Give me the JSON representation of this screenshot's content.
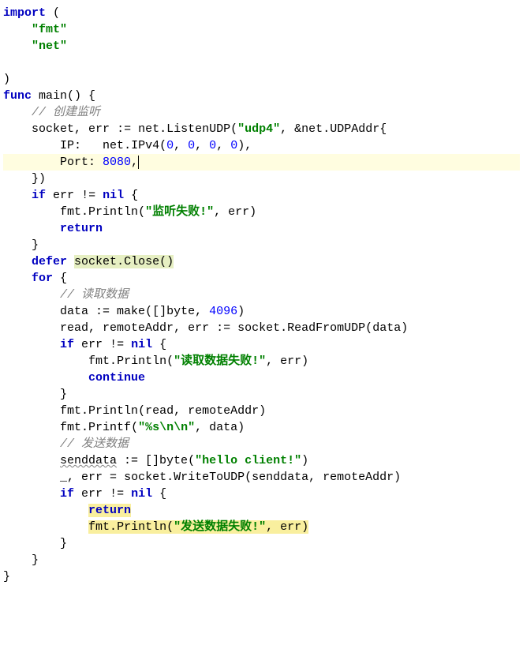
{
  "kw": {
    "import": "import",
    "func": "func",
    "if": "if",
    "defer": "defer",
    "for": "for",
    "return": "return",
    "continue": "continue"
  },
  "id": {
    "main": "main",
    "socket": "socket",
    "err": "err",
    "net": "net",
    "ListenUDP": "ListenUDP",
    "UDPAddr": "UDPAddr",
    "IP": "IP",
    "IPv4": "IPv4",
    "Port": "Port",
    "nil": "nil",
    "fmt": "fmt",
    "Println": "Println",
    "Printf": "Printf",
    "Close": "Close",
    "data": "data",
    "make": "make",
    "byte": "byte",
    "read": "read",
    "remoteAddr": "remoteAddr",
    "ReadFromUDP": "ReadFromUDP",
    "senddata": "senddata",
    "WriteToUDP": "WriteToUDP"
  },
  "str": {
    "fmt": "\"fmt\"",
    "net": "\"net\"",
    "udp4": "\"udp4\"",
    "listen_fail": "\"监听失败!\"",
    "read_fail": "\"读取数据失败!\"",
    "fmtspec": "\"%s\\n\\n\"",
    "hello": "\"hello client!\"",
    "send_fail": "\"发送数据失败!\""
  },
  "num": {
    "zero": "0",
    "port": "8080",
    "bufsize": "4096"
  },
  "cmt": {
    "create_listen": "// 创建监听",
    "read_data": "// 读取数据",
    "send_data": "// 发送数据"
  }
}
